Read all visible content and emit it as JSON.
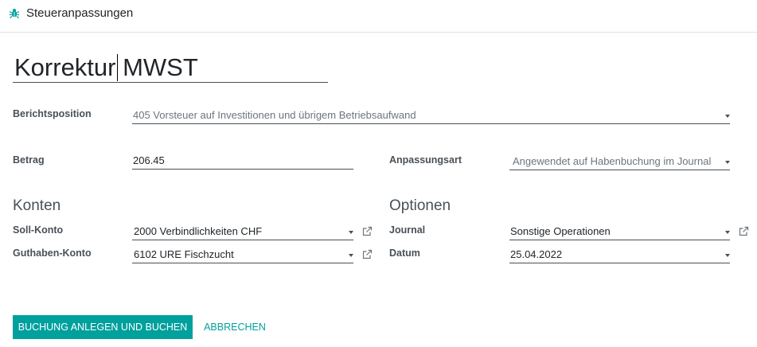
{
  "header": {
    "title": "Steueranpassungen",
    "icon": "bug-icon"
  },
  "form": {
    "name": "Korrektur MWST",
    "report_line": {
      "label": "Berichtsposition",
      "value": "405 Vorsteuer auf Investitionen und übrigem Betriebsaufwand"
    },
    "amount": {
      "label": "Betrag",
      "value": "206.45"
    },
    "adjustment_type": {
      "label": "Anpassungsart",
      "value": "Angewendet auf Habenbuchung im Journal"
    },
    "accounts": {
      "title": "Konten",
      "debit": {
        "label": "Soll-Konto",
        "value": "2000 Verbindlichkeiten CHF"
      },
      "credit": {
        "label": "Guthaben-Konto",
        "value": "6102 URE Fischzucht"
      }
    },
    "options": {
      "title": "Optionen",
      "journal": {
        "label": "Journal",
        "value": "Sonstige Operationen"
      },
      "date": {
        "label": "Datum",
        "value": "25.04.2022"
      }
    }
  },
  "buttons": {
    "create_post": "BUCHUNG ANLEGEN UND BUCHEN",
    "cancel": "ABBRECHEN"
  },
  "colors": {
    "accent": "#00a09d",
    "text": "#212529",
    "label": "#495057",
    "border": "#495057"
  }
}
